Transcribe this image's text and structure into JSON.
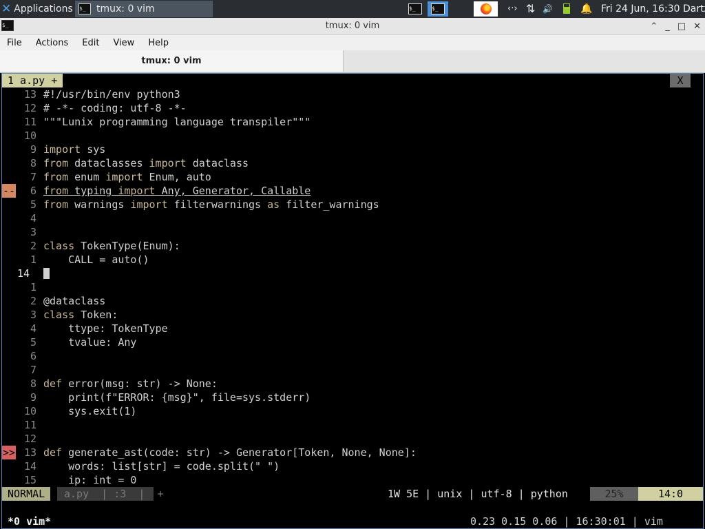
{
  "panel": {
    "applications_label": "Applications",
    "task_label": "tmux: 0 vim",
    "tray_network": "‹·›",
    "tray_updown": "⇅",
    "tray_volume": "🔊",
    "clock": "Fri 24 Jun, 16:30",
    "user": "Dartz"
  },
  "window": {
    "title": "tmux: 0 vim",
    "minimize": "_",
    "maximize": "^",
    "restore": "□",
    "close": "✕"
  },
  "menu": [
    "File",
    "Actions",
    "Edit",
    "View",
    "Help"
  ],
  "tab": {
    "label": "tmux: 0 vim"
  },
  "vim": {
    "tab_label": "1 a.py +",
    "tab_close": "X",
    "lines": [
      {
        "nr": "13",
        "code": "#!/usr/bin/env python3"
      },
      {
        "nr": "12",
        "code": "# -*- coding: utf-8 -*-"
      },
      {
        "nr": "11",
        "code": "\"\"\"Lunix programming language transpiler\"\"\""
      },
      {
        "nr": "10",
        "code": ""
      },
      {
        "nr": "9",
        "code": "import sys"
      },
      {
        "nr": "8",
        "code": "from dataclasses import dataclass"
      },
      {
        "nr": "7",
        "code": "from enum import Enum, auto"
      },
      {
        "nr": "6",
        "code": "from typing import Any, Generator, Callable",
        "sign": "--"
      },
      {
        "nr": "5",
        "code": "from warnings import filterwarnings as filter_warnings"
      },
      {
        "nr": "4",
        "code": ""
      },
      {
        "nr": "3",
        "code": ""
      },
      {
        "nr": "2",
        "code": "class TokenType(Enum):"
      },
      {
        "nr": "1",
        "code": "    CALL = auto()"
      },
      {
        "nr": "14",
        "code": "",
        "current": true
      },
      {
        "nr": "1",
        "code": ""
      },
      {
        "nr": "2",
        "code": "@dataclass"
      },
      {
        "nr": "3",
        "code": "class Token:"
      },
      {
        "nr": "4",
        "code": "    ttype: TokenType"
      },
      {
        "nr": "5",
        "code": "    tvalue: Any"
      },
      {
        "nr": "6",
        "code": ""
      },
      {
        "nr": "7",
        "code": ""
      },
      {
        "nr": "8",
        "code": "def error(msg: str) -> None:"
      },
      {
        "nr": "9",
        "code": "    print(f\"ERROR: {msg}\", file=sys.stderr)"
      },
      {
        "nr": "10",
        "code": "    sys.exit(1)"
      },
      {
        "nr": "11",
        "code": ""
      },
      {
        "nr": "12",
        "code": ""
      },
      {
        "nr": "13",
        "code": "def generate_ast(code: str) -> Generator[Token, None, None]:",
        "sign": ">>"
      },
      {
        "nr": "14",
        "code": "    words: list[str] = code.split(\" \")"
      },
      {
        "nr": "15",
        "code": "    ip: int = 0"
      }
    ],
    "status": {
      "mode": "NORMAL",
      "file": "a.py  | :3  |  +",
      "info": "1W 5E | unix | utf-8 | python",
      "percent": "25%",
      "position": "14:0"
    }
  },
  "tmux": {
    "window": "*0 vim*",
    "right": "0.23 0.15 0.06 | 16:30:01 | vim"
  }
}
